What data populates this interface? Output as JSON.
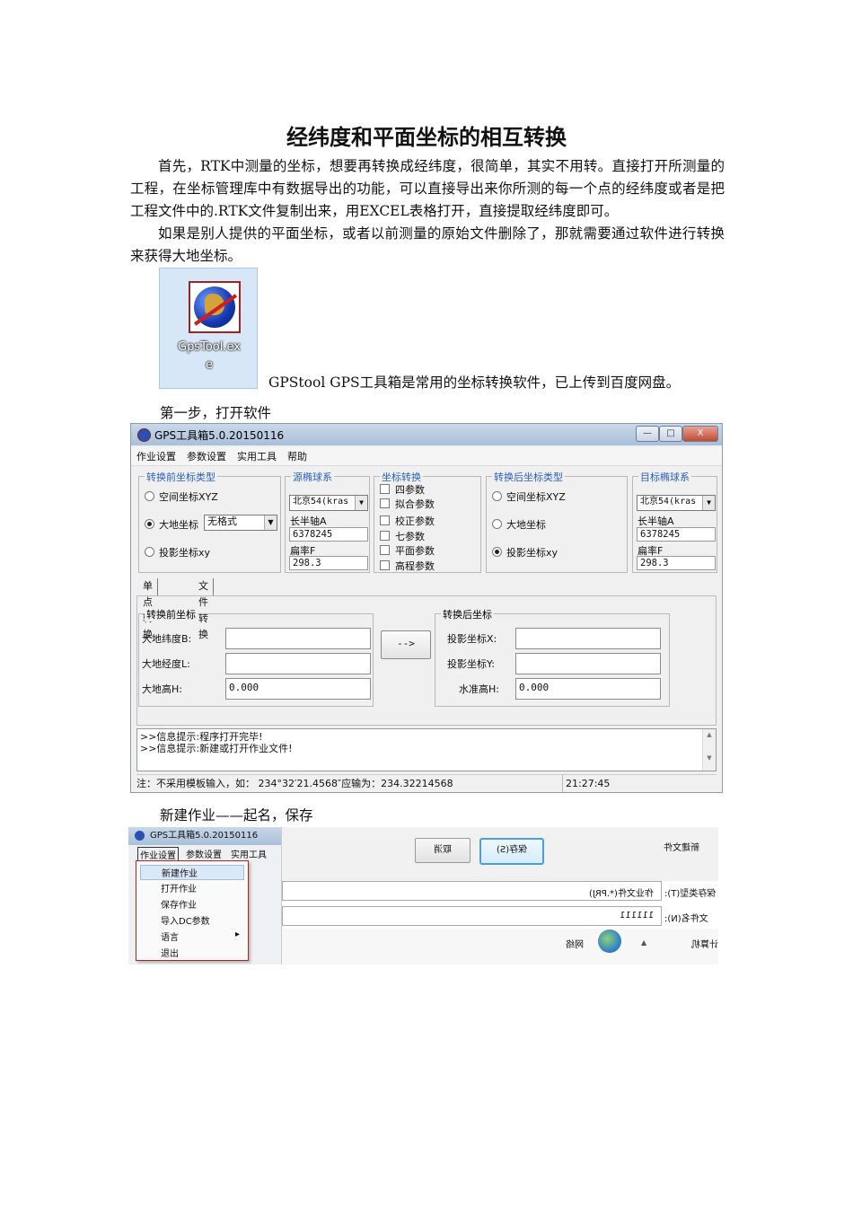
{
  "document": {
    "title": "经纬度和平面坐标的相互转换",
    "paragraph1": "首先，RTK中测量的坐标，想要再转换成经纬度，很简单，其实不用转。直接打开所测量的工程，在坐标管理库中有数据导出的功能，可以直接导出来你所测的每一个点的经纬度或者是把工程文件中的.RTK文件复制出来，用EXCEL表格打开，直接提取经纬度即可。",
    "paragraph2": "如果是别人提供的平面坐标，或者以前测量的原始文件删除了，那就需要通过软件进行转换来获得大地坐标。",
    "icon_label_line1": "GpsTool.ex",
    "icon_label_line2": "e",
    "icon_caption": "GPStool GPS工具箱是常用的坐标转换软件，已上传到百度网盘。",
    "step1": "第一步，打开软件",
    "step2": "新建作业——起名，保存"
  },
  "app": {
    "title": "GPS工具箱5.0.20150116",
    "window_buttons": [
      "—",
      "□",
      "X"
    ],
    "menu": [
      "作业设置",
      "参数设置",
      "实用工具",
      "帮助"
    ],
    "source_type": {
      "title": "转换前坐标类型",
      "options": [
        "空间坐标XYZ",
        "大地坐标",
        "投影坐标xy"
      ],
      "geodetic_format": "无格式"
    },
    "source_ellipsoid": {
      "title": "源椭球系",
      "ellipsoid": "北京54(kras",
      "semi_major_label": "长半轴A",
      "semi_major": "6378245",
      "flattening_label": "扁率F",
      "flattening": "298.3"
    },
    "coord_conversion": {
      "title": "坐标转换",
      "options": [
        "四参数",
        "拟合参数",
        "校正参数",
        "七参数",
        "平面参数",
        "高程参数"
      ]
    },
    "target_type": {
      "title": "转换后坐标类型",
      "options": [
        "空间坐标XYZ",
        "大地坐标",
        "投影坐标xy"
      ]
    },
    "target_ellipsoid": {
      "title": "目标椭球系",
      "ellipsoid": "北京54(kras",
      "semi_major_label": "长半轴A",
      "semi_major": "6378245",
      "flattening_label": "扁率F",
      "flattening": "298.3"
    },
    "tabs": [
      "单点转换",
      "文件转换"
    ],
    "input_group": {
      "title": "转换前坐标",
      "lat_label": "大地纬度B:",
      "lon_label": "大地经度L:",
      "height_label": "大地高H:",
      "lat": "",
      "lon": "",
      "height": "0.000"
    },
    "convert_button": "-->",
    "output_group": {
      "title": "转换后坐标",
      "x_label": "投影坐标X:",
      "y_label": "投影坐标Y:",
      "h_label": "水准高H:",
      "x": "",
      "y": "",
      "h": "0.000"
    },
    "log": [
      ">>信息提示:程序打开完毕!",
      ">>信息提示:新建或打开作业文件!"
    ],
    "status_hint": "注：不采用模板输入，如： 234°32′21.4568″应输为：234.32214568",
    "status_time": "21:27:45"
  },
  "app2": {
    "title": "GPS工具箱5.0.20150116",
    "menu": [
      "作业设置",
      "参数设置",
      "实用工具"
    ],
    "job_menu": [
      "新建作业",
      "打开作业",
      "保存作业",
      "导入DC参数",
      "语言",
      "退出"
    ],
    "dialog_title": "新建文件",
    "save_button": "保存(S)",
    "cancel_button": "取消",
    "save_type_label": "保存类型(T):",
    "save_type_value": "作业文件(*.PRJ)",
    "filename_label": "文件名(N):",
    "filename_value": "111111",
    "network_label": "网络",
    "peer_label": "计算机"
  }
}
